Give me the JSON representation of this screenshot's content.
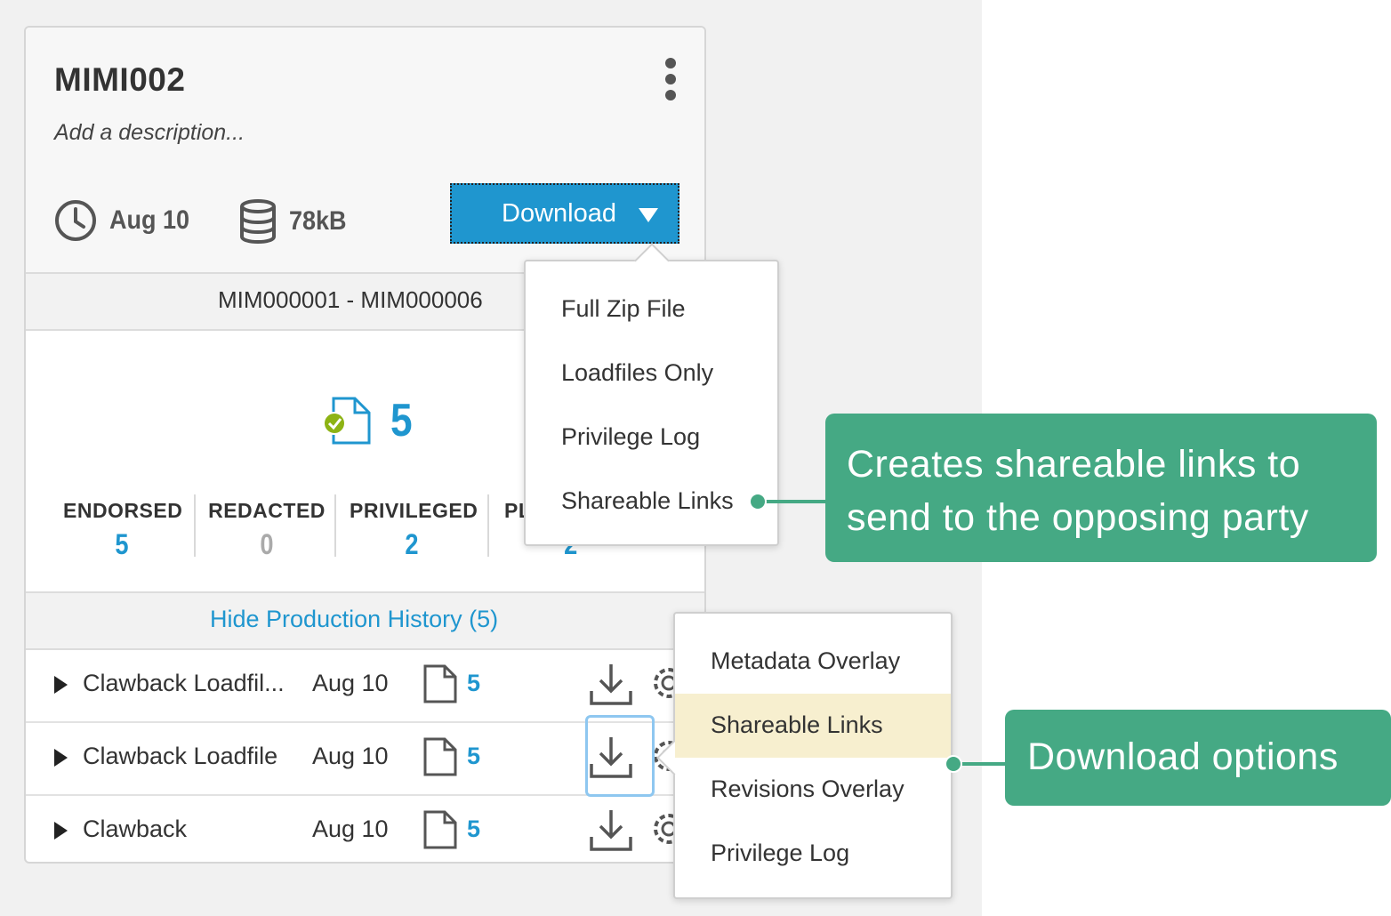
{
  "card": {
    "title": "MIMI002",
    "description_placeholder": "Add a description...",
    "date": "Aug 10",
    "size": "78kB",
    "download_label": "Download",
    "range": "MIM000001 - MIM000006",
    "doc_count": "5"
  },
  "stats": [
    {
      "label": "ENDORSED",
      "value": "5",
      "color": "#1f96cf"
    },
    {
      "label": "REDACTED",
      "value": "0",
      "color": "#aaaaaa"
    },
    {
      "label": "PRIVILEGED",
      "value": "2",
      "color": "#1f96cf"
    },
    {
      "label": "PL",
      "value": "2",
      "color": "#1f96cf"
    }
  ],
  "history": {
    "toggle_label": "Hide Production History (5)",
    "rows": [
      {
        "name": "Clawback Loadfil...",
        "date": "Aug 10",
        "count": "5"
      },
      {
        "name": "Clawback Loadfile",
        "date": "Aug 10",
        "count": "5"
      },
      {
        "name": "Clawback",
        "date": "Aug 10",
        "count": "5"
      }
    ]
  },
  "download_menu": {
    "items": [
      "Full Zip File",
      "Loadfiles Only",
      "Privilege Log",
      "Shareable Links"
    ]
  },
  "row_download_menu": {
    "items": [
      "Metadata Overlay",
      "Shareable Links",
      "Revisions Overlay",
      "Privilege Log"
    ],
    "highlighted": "Shareable Links"
  },
  "callouts": {
    "shareable_line1": "Creates shareable links to",
    "shareable_line2": "send to the opposing party",
    "download_options": "Download options"
  },
  "colors": {
    "accent": "#1f96cf",
    "callout": "#45a984",
    "highlight": "#f7efcf",
    "check": "#8db314"
  }
}
